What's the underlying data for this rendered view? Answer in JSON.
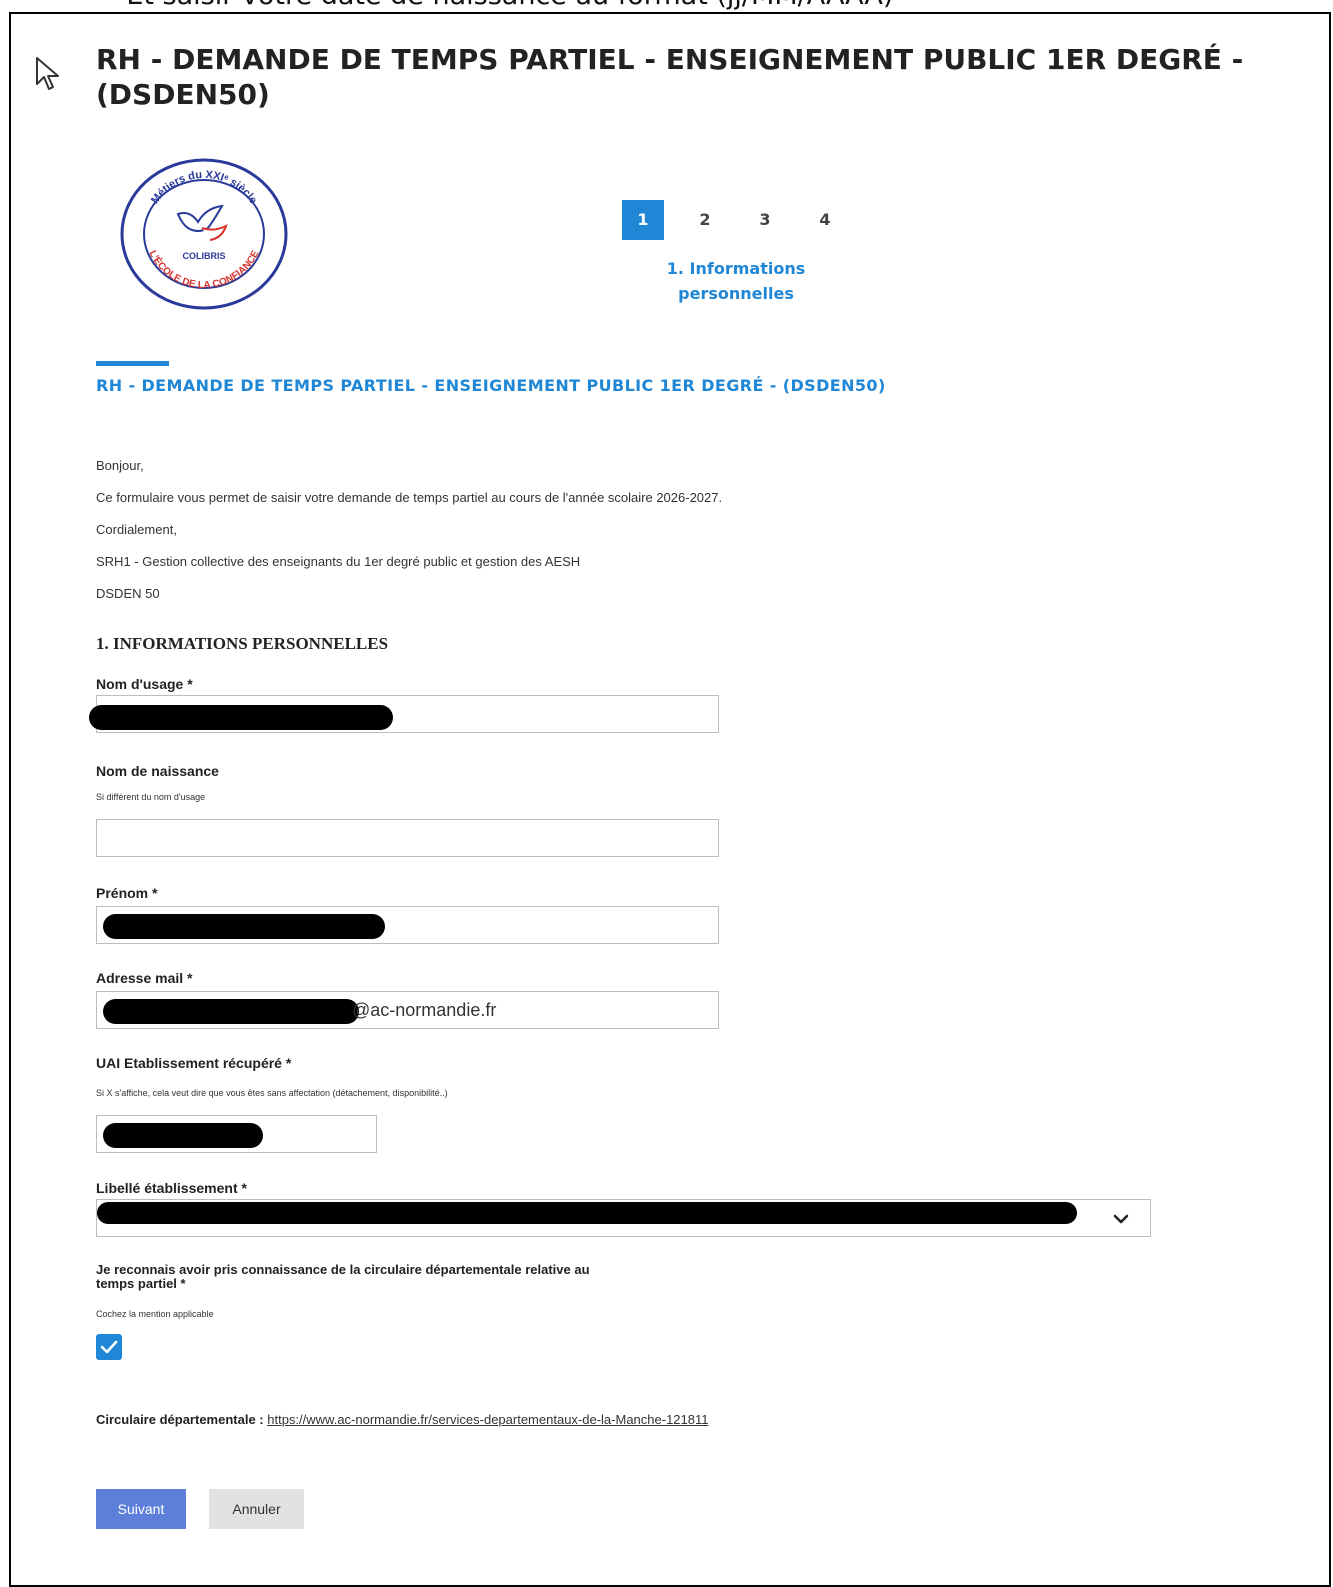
{
  "caption": "- Et saisir votre date de naissance au format (jj/MM/AAAA)",
  "page_title": "RH - DEMANDE DE TEMPS PARTIEL - ENSEIGNEMENT PUBLIC 1ER DEGRÉ - (DSDEN50)",
  "logo": {
    "top_text": "Métiers du XXIᵉ siècle",
    "center_text": "COLIBRIS",
    "bottom_text": "L'ÉCOLE DE LA CONFIANCE"
  },
  "stepper": {
    "steps": [
      "1",
      "2",
      "3",
      "4"
    ],
    "active_step": 1,
    "label_line1": "1. Informations",
    "label_line2": "personnelles"
  },
  "form_title": "RH - DEMANDE DE TEMPS PARTIEL - ENSEIGNEMENT PUBLIC 1ER DEGRÉ - (DSDEN50)",
  "intro": {
    "line1": "Bonjour,",
    "line2": "Ce formulaire vous permet de saisir votre demande de temps partiel au cours de l'année scolaire 2026-2027.",
    "line3": "Cordialement,",
    "line4": "SRH1 - Gestion collective des enseignants du 1er degré public et gestion des AESH",
    "line5": "DSDEN 50"
  },
  "section_title": "1. INFORMATIONS PERSONNELLES",
  "fields": {
    "nom_usage": {
      "label": "Nom d'usage *"
    },
    "nom_naissance": {
      "label": "Nom de naissance",
      "hint": "Si différent du nom d'usage"
    },
    "prenom": {
      "label": "Prénom *"
    },
    "email": {
      "label": "Adresse mail *",
      "visible_value": "@ac-normandie.fr"
    },
    "uai": {
      "label": "UAI Etablissement récupéré *",
      "hint": "Si X s'affiche, cela veut dire que vous êtes sans affectation (détachement, disponibilité..)"
    },
    "libelle": {
      "label": "Libellé établissement *"
    }
  },
  "consent": {
    "label_line1": "Je reconnais avoir pris connaissance de la circulaire départementale relative au",
    "label_line2": "temps partiel *",
    "hint": "Cochez la mention applicable",
    "checked": true
  },
  "circular": {
    "label": "Circulaire départementale : ",
    "link": "https://www.ac-normandie.fr/services-departementaux-de-la-Manche-121811"
  },
  "buttons": {
    "next": "Suivant",
    "cancel": "Annuler"
  },
  "colors": {
    "accent": "#1f87d6",
    "primary_button": "#5d7fd9",
    "secondary_button": "#e2e2e2"
  }
}
